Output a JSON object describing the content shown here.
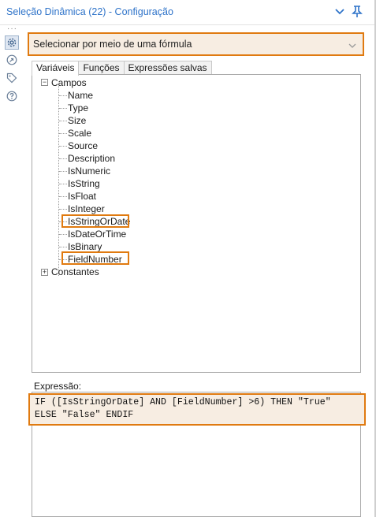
{
  "header": {
    "title": "Seleção Dinâmica (22) - Configuração",
    "collapse_icon": "chevron-down-icon",
    "pin_icon": "pin-icon"
  },
  "sidebar": {
    "more": "···",
    "items": [
      {
        "icon": "gear-icon",
        "active": true
      },
      {
        "icon": "compass-icon",
        "active": false
      },
      {
        "icon": "tag-icon",
        "active": false
      },
      {
        "icon": "help-icon",
        "active": false
      }
    ]
  },
  "mode_select": {
    "value": "Selecionar por meio de uma fórmula"
  },
  "tabs": [
    {
      "label": "Variáveis",
      "active": true
    },
    {
      "label": "Funções",
      "active": false
    },
    {
      "label": "Expressões salvas",
      "active": false
    }
  ],
  "tree": {
    "fields_root": "Campos",
    "fields": [
      "Name",
      "Type",
      "Size",
      "Scale",
      "Source",
      "Description",
      "IsNumeric",
      "IsString",
      "IsFloat",
      "IsInteger",
      "IsStringOrDate",
      "IsDateOrTime",
      "IsBinary",
      "FieldNumber"
    ],
    "constants_root": "Constantes",
    "highlighted": [
      "IsStringOrDate",
      "FieldNumber"
    ]
  },
  "expression": {
    "label": "Expressão:",
    "line1": "IF ([IsStringOrDate] AND [FieldNumber] >6) THEN \"True\"",
    "line2": "ELSE \"False\" ENDIF"
  },
  "colors": {
    "accent_orange": "#e07a10",
    "title_blue": "#2e73c9",
    "highlight_bg": "#f7ede2"
  }
}
